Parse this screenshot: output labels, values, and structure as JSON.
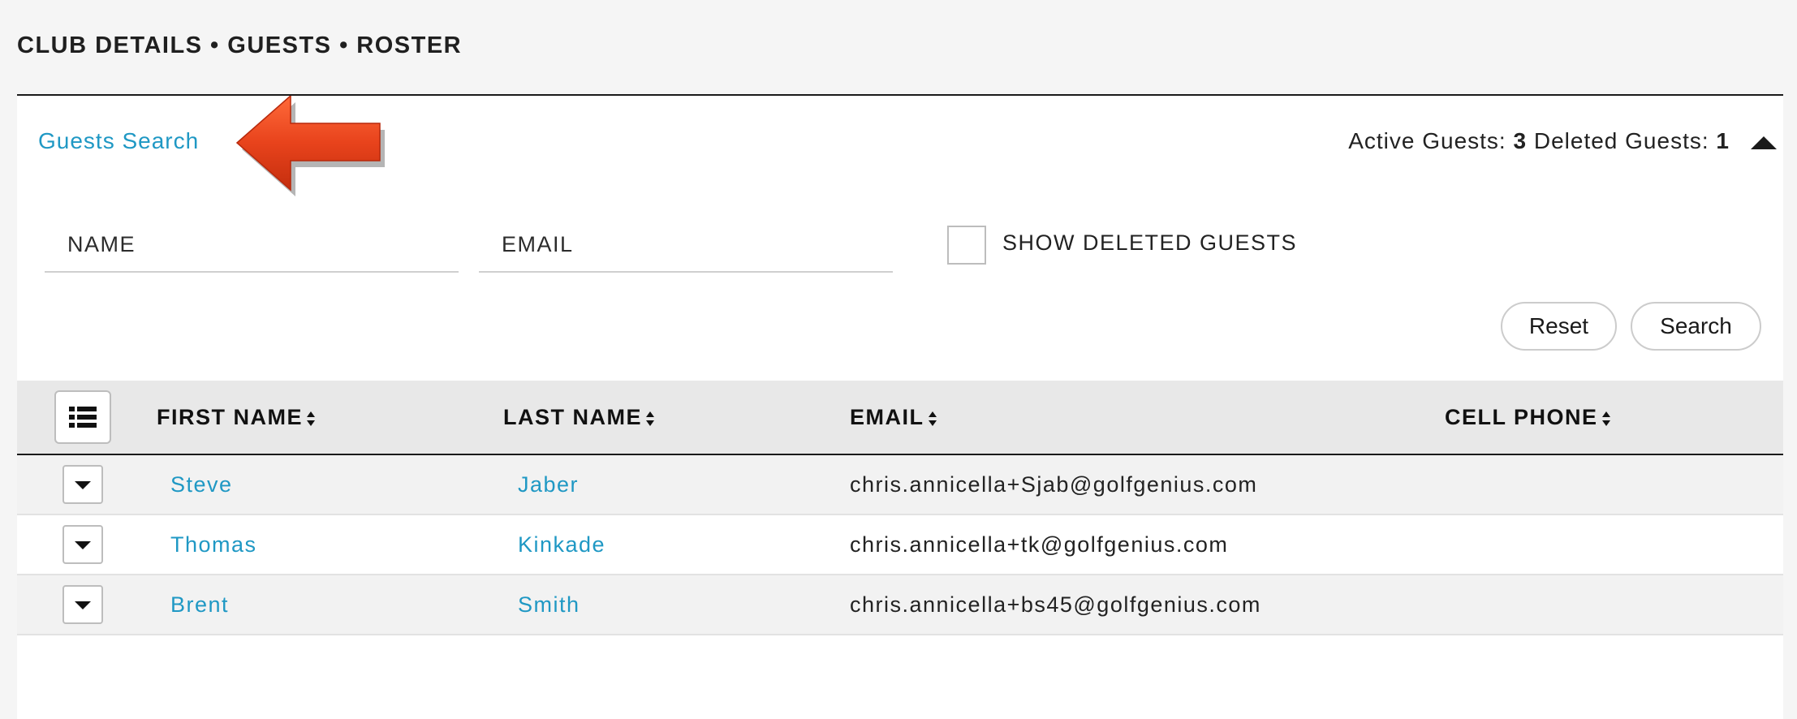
{
  "breadcrumb": "CLUB DETAILS • GUESTS • ROSTER",
  "search_panel": {
    "title_link": "Guests Search",
    "counts": {
      "active_label": "Active Guests:",
      "active_value": "3",
      "deleted_label": "Deleted Guests:",
      "deleted_value": "1"
    },
    "name_placeholder": "NAME",
    "email_placeholder": "EMAIL",
    "show_deleted_label": "SHOW DELETED GUESTS",
    "show_deleted_checked": false,
    "reset_label": "Reset",
    "search_label": "Search"
  },
  "annotation": {
    "arrow_color": "#e8431c"
  },
  "table": {
    "headers": {
      "first_name": "FIRST NAME",
      "last_name": "LAST NAME",
      "email": "EMAIL",
      "cell_phone": "CELL PHONE"
    },
    "rows": [
      {
        "first": "Steve",
        "last": "Jaber",
        "email": "chris.annicella+Sjab@golfgenius.com",
        "phone": ""
      },
      {
        "first": "Thomas",
        "last": "Kinkade",
        "email": "chris.annicella+tk@golfgenius.com",
        "phone": ""
      },
      {
        "first": "Brent",
        "last": "Smith",
        "email": "chris.annicella+bs45@golfgenius.com",
        "phone": ""
      }
    ]
  },
  "colors": {
    "link": "#1f98c4",
    "header_bg": "#e8e8e8"
  }
}
